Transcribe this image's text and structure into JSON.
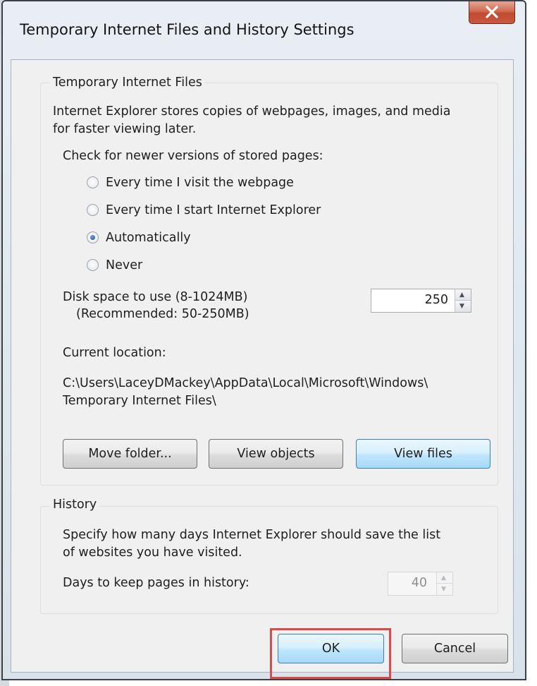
{
  "dialog": {
    "title": "Temporary Internet Files and History Settings",
    "close_icon": "close-x-icon"
  },
  "temp_files": {
    "group_label": "Temporary Internet Files",
    "description_line1": "Internet Explorer stores copies of webpages, images, and media",
    "description_line2": "for faster viewing later.",
    "check_label": "Check for newer versions of stored pages:",
    "options": [
      {
        "label": "Every time I visit the webpage",
        "checked": false
      },
      {
        "label": "Every time I start Internet Explorer",
        "checked": false
      },
      {
        "label": "Automatically",
        "checked": true
      },
      {
        "label": "Never",
        "checked": false
      }
    ],
    "disk_space_label": "Disk space to use (8-1024MB)",
    "disk_space_recommended": "(Recommended: 50-250MB)",
    "disk_space_value": "250",
    "current_location_label": "Current location:",
    "location_line1": "C:\\Users\\LaceyDMackey\\AppData\\Local\\Microsoft\\Windows\\",
    "location_line2": "Temporary Internet Files\\",
    "buttons": {
      "move_folder": "Move folder...",
      "view_objects": "View objects",
      "view_files": "View files"
    }
  },
  "history": {
    "group_label": "History",
    "description_line1": "Specify how many days Internet Explorer should save the list",
    "description_line2": "of websites you have visited.",
    "days_label": "Days to keep pages in history:",
    "days_value": "40"
  },
  "footer": {
    "ok_label": "OK",
    "cancel_label": "Cancel"
  },
  "colors": {
    "highlight_border": "#d94a4a",
    "focused_button": "#bee6fd",
    "close_button": "#c14a30"
  }
}
